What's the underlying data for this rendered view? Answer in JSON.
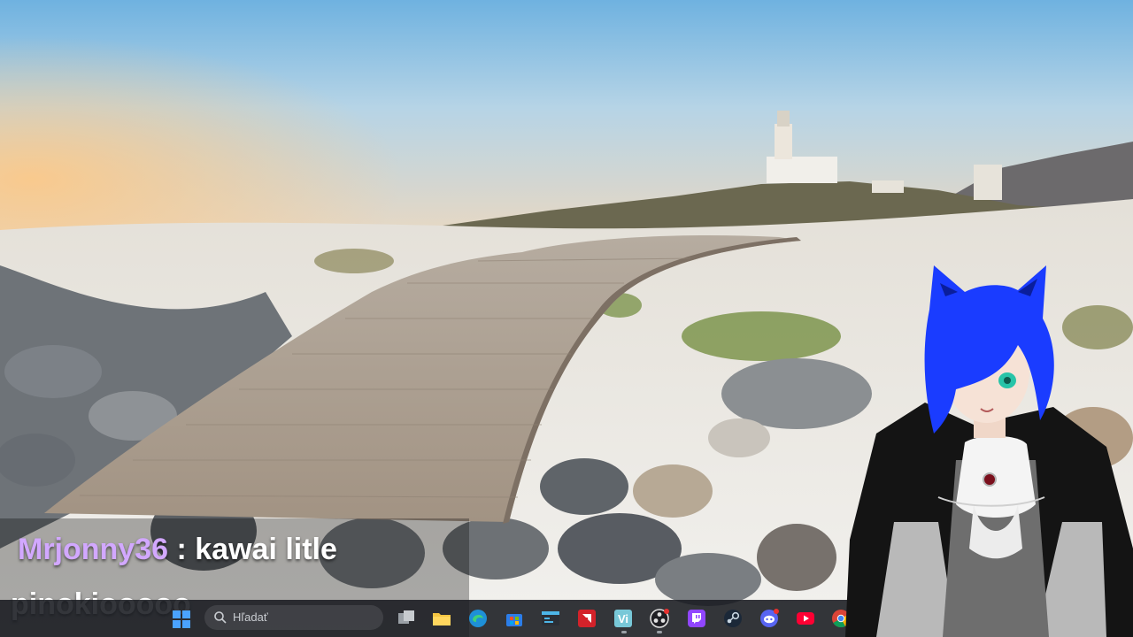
{
  "chat": {
    "username": "Mrjonny36",
    "separator": " : ",
    "message_line1": "kawai litle",
    "message_line2": "pinokiooooo"
  },
  "taskbar": {
    "search_placeholder": "Hľadať",
    "icons": [
      "windows-start-icon",
      "task-view-icon",
      "file-explorer-icon",
      "edge-icon",
      "microsoft-store-icon",
      "terminal-icon",
      "amd-icon",
      "vi-app-icon",
      "obs-icon",
      "twitch-icon",
      "steam-icon",
      "discord-icon",
      "youtube-icon",
      "chrome-icon"
    ]
  },
  "colors": {
    "username": "#d2a8ff",
    "chat_text": "#ffffff",
    "taskbar_bg": "#181a20",
    "vtuber_hair": "#1a3cff"
  }
}
